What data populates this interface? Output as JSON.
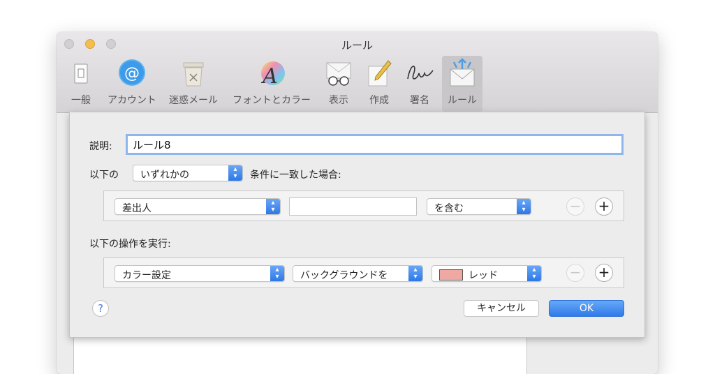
{
  "window": {
    "title": "ルール"
  },
  "toolbar": {
    "items": [
      {
        "label": "一般",
        "icon": "switch-icon"
      },
      {
        "label": "アカウント",
        "icon": "at-sign-icon"
      },
      {
        "label": "迷惑メール",
        "icon": "junk-trash-icon"
      },
      {
        "label": "フォントとカラー",
        "icon": "font-color-icon"
      },
      {
        "label": "表示",
        "icon": "glasses-icon"
      },
      {
        "label": "作成",
        "icon": "pencil-icon"
      },
      {
        "label": "署名",
        "icon": "signature-icon"
      },
      {
        "label": "ルール",
        "icon": "rules-envelope-icon",
        "selected": true
      }
    ]
  },
  "rule": {
    "description_label": "説明:",
    "description_value": "ルール8",
    "if_prefix": "以下の",
    "match_mode": "いずれかの",
    "if_suffix": "条件に一致した場合:",
    "condition": {
      "field": "差出人",
      "value": "",
      "operator": "を含む"
    },
    "actions_label": "以下の操作を実行:",
    "action": {
      "type": "カラー設定",
      "target": "バックグラウンドを",
      "color_name": "レッド",
      "color_hex": "#f0a8a2"
    }
  },
  "buttons": {
    "help": "?",
    "cancel": "キャンセル",
    "ok": "OK",
    "remove": "−",
    "add": "+"
  }
}
